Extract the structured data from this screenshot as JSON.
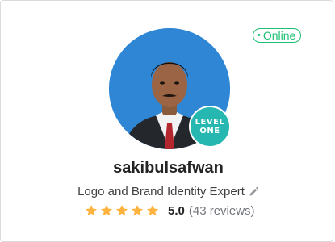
{
  "status": {
    "label": "Online",
    "color": "#1dbf73"
  },
  "profile": {
    "username": "sakibulsafwan",
    "tagline": "Logo and Brand Identity Expert",
    "avatar_icon": "profile-photo",
    "level": {
      "line1": "LEVEL",
      "line2": "ONE"
    }
  },
  "rating": {
    "stars": 5,
    "score": "5.0",
    "reviews": "(43 reviews)",
    "star_color": "#ffb33e"
  }
}
